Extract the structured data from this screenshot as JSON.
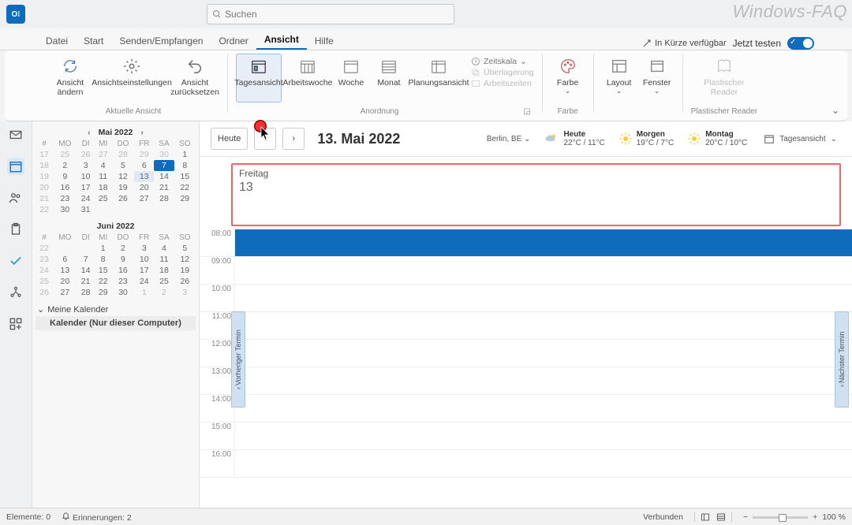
{
  "app_icon_text": "O⁝",
  "search_placeholder": "Suchen",
  "watermark": "Windows-FAQ",
  "tabs": [
    "Datei",
    "Start",
    "Senden/Empfangen",
    "Ordner",
    "Ansicht",
    "Hilfe"
  ],
  "active_tab_index": 4,
  "coming_soon": "In Kürze verfügbar",
  "try_now": "Jetzt testen",
  "ribbon": {
    "groups": {
      "current_view": {
        "label": "Aktuelle Ansicht",
        "change": "Ansicht ändern",
        "settings": "Ansichtseinstellungen",
        "reset": "Ansicht zurücksetzen"
      },
      "arrangement": {
        "label": "Anordnung",
        "day": "Tagesansicht",
        "workweek": "Arbeitswoche",
        "week": "Woche",
        "month": "Monat",
        "schedule": "Planungsansicht",
        "timescale": "Zeitskala",
        "overlay": "Überlagerung",
        "worktimes": "Arbeitszeiten"
      },
      "color": {
        "label": "Farbe",
        "btn": "Farbe"
      },
      "layout": {
        "label": "",
        "btn": "Layout"
      },
      "window": {
        "btn": "Fenster"
      },
      "reader": {
        "label": "Plastischer Reader",
        "btn": "Plastischer Reader"
      }
    }
  },
  "minicals": [
    {
      "title": "Mai 2022",
      "dows": [
        "#",
        "MO",
        "DI",
        "MI",
        "DO",
        "FR",
        "SA",
        "SO"
      ],
      "rows": [
        [
          "17",
          "25",
          "26",
          "27",
          "28",
          "29",
          "30",
          "1"
        ],
        [
          "18",
          "2",
          "3",
          "4",
          "5",
          "6",
          "7",
          "8"
        ],
        [
          "19",
          "9",
          "10",
          "11",
          "12",
          "13",
          "14",
          "15"
        ],
        [
          "20",
          "16",
          "17",
          "18",
          "19",
          "20",
          "21",
          "22"
        ],
        [
          "21",
          "23",
          "24",
          "25",
          "26",
          "27",
          "28",
          "29"
        ],
        [
          "22",
          "30",
          "31",
          "",
          "",
          "",
          "",
          ""
        ]
      ],
      "dim_first_row_count": 6,
      "today": [
        1,
        6
      ],
      "sel": [
        2,
        5
      ]
    },
    {
      "title": "Juni 2022",
      "dows": [
        "#",
        "MO",
        "DI",
        "MI",
        "DO",
        "FR",
        "SA",
        "SO"
      ],
      "rows": [
        [
          "22",
          "",
          "",
          "1",
          "2",
          "3",
          "4",
          "5"
        ],
        [
          "23",
          "6",
          "7",
          "8",
          "9",
          "10",
          "11",
          "12"
        ],
        [
          "24",
          "13",
          "14",
          "15",
          "16",
          "17",
          "18",
          "19"
        ],
        [
          "25",
          "20",
          "21",
          "22",
          "23",
          "24",
          "25",
          "26"
        ],
        [
          "26",
          "27",
          "28",
          "29",
          "30",
          "1",
          "2",
          "3"
        ]
      ],
      "dim_last_row_start": 5
    }
  ],
  "my_calendars_hdr": "Meine Kalender",
  "my_calendars_item": "Kalender (Nur dieser Computer)",
  "today_btn": "Heute",
  "date_title": "13. Mai 2022",
  "location": "Berlin, BE",
  "weather": [
    {
      "icon": "cloud",
      "label": "Heute",
      "temp": "22°C / 11°C"
    },
    {
      "icon": "sun",
      "label": "Morgen",
      "temp": "19°C / 7°C"
    },
    {
      "icon": "sun",
      "label": "Montag",
      "temp": "20°C / 10°C"
    }
  ],
  "view_selector": "Tagesansicht",
  "day_name": "Freitag",
  "day_number": "13",
  "time_slots": [
    "08:00",
    "09:00",
    "10:00",
    "11:00",
    "12:00",
    "13:00",
    "14:00",
    "15:00",
    "16:00"
  ],
  "prev_appt": "Vorheriger Termin",
  "next_appt": "Nächster Termin",
  "status": {
    "elements": "Elemente: 0",
    "reminders": "Erinnerungen: 2",
    "connected": "Verbunden",
    "zoom": "100 %"
  }
}
